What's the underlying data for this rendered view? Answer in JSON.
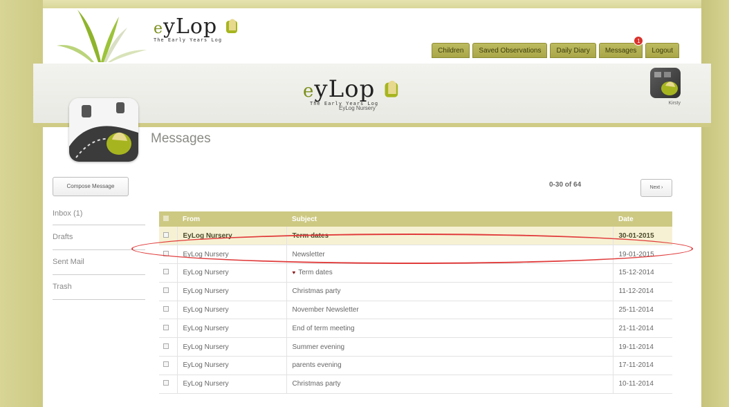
{
  "logo": {
    "word": "yLop",
    "prefix": "e",
    "tagline": "The Early Years Log"
  },
  "nav": {
    "tabs": [
      {
        "label": "Children"
      },
      {
        "label": "Saved Observations"
      },
      {
        "label": "Daily Diary"
      },
      {
        "label": "Messages",
        "badge": "1"
      },
      {
        "label": "Logout"
      }
    ]
  },
  "banner": {
    "subtitle": "EyLog Nursery",
    "user_name": "Kirsty"
  },
  "page": {
    "title": "Messages"
  },
  "sidebar": {
    "compose_label": "Compose Message",
    "items": [
      {
        "label": "Inbox (1)"
      },
      {
        "label": "Drafts"
      },
      {
        "label": "Sent Mail"
      },
      {
        "label": "Trash"
      }
    ]
  },
  "pager": {
    "range": "0-30 of 64",
    "next_label": "Next ›"
  },
  "table": {
    "headers": {
      "from": "From",
      "subject": "Subject",
      "date": "Date"
    },
    "rows": [
      {
        "from": "EyLog Nursery",
        "subject": "Term dates",
        "date": "30-01-2015",
        "unread": true,
        "flag": false
      },
      {
        "from": "EyLog Nursery",
        "subject": "Newsletter",
        "date": "19-01-2015",
        "unread": false,
        "flag": false
      },
      {
        "from": "EyLog Nursery",
        "subject": "Term dates",
        "date": "15-12-2014",
        "unread": false,
        "flag": true
      },
      {
        "from": "EyLog Nursery",
        "subject": "Christmas party",
        "date": "11-12-2014",
        "unread": false,
        "flag": false
      },
      {
        "from": "EyLog Nursery",
        "subject": "November Newsletter",
        "date": "25-11-2014",
        "unread": false,
        "flag": false
      },
      {
        "from": "EyLog Nursery",
        "subject": "End of term meeting",
        "date": "21-11-2014",
        "unread": false,
        "flag": false
      },
      {
        "from": "EyLog Nursery",
        "subject": "Summer evening",
        "date": "19-11-2014",
        "unread": false,
        "flag": false
      },
      {
        "from": "EyLog Nursery",
        "subject": "parents evening",
        "date": "17-11-2014",
        "unread": false,
        "flag": false
      },
      {
        "from": "EyLog Nursery",
        "subject": "Christmas party",
        "date": "10-11-2014",
        "unread": false,
        "flag": false
      }
    ]
  },
  "colors": {
    "accent": "#cdc983",
    "nav_tab": "#b3b150",
    "highlight": "#e03b3b",
    "badge": "#d9322b"
  },
  "icons": {
    "flag": "heart-flag-icon",
    "leaf": "bamboo-leaf-icon",
    "app": "eylog-app-icon"
  }
}
